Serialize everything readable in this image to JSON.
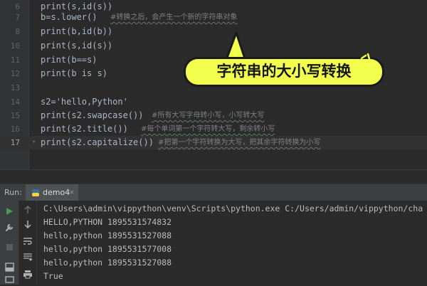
{
  "editor": {
    "lines": [
      {
        "num": "6",
        "code": "print(s,id(s))"
      },
      {
        "num": "7",
        "code": "b=s.lower()",
        "comment": "#转换之后，会产生一个新的字符串对象"
      },
      {
        "num": "8",
        "code": "print(b,id(b))"
      },
      {
        "num": "10",
        "code": "print(s,id(s))"
      },
      {
        "num": "11",
        "code": "print(b==s)"
      },
      {
        "num": "12",
        "code": "print(b is s)"
      },
      {
        "num": "13",
        "code": ""
      },
      {
        "num": "14",
        "code": "s2='hello,Python'"
      },
      {
        "num": "15",
        "code": "print(s2.swapcase())",
        "comment": "#所有大写字母转小写，小写转大写"
      },
      {
        "num": "16",
        "code": "print(s2.title())",
        "comment": "#每个单词第一个字符转大写，剩余转小写"
      },
      {
        "num": "17",
        "code": "print(s2.capitalize())",
        "comment": "#把第一个字符转换为大写，把其余字符转换为小写"
      }
    ]
  },
  "callout": {
    "text": "字符串的大小写转换",
    "bg": "#f3ff4d"
  },
  "run": {
    "label": "Run:",
    "tab": {
      "label": "demo4",
      "icon": "python-icon"
    }
  },
  "console": {
    "lines": [
      "C:\\Users\\admin\\vippython\\venv\\Scripts\\python.exe C:/Users/admin/vippython/cha",
      "HELLO,PYTHON 1895531574832",
      "hello,python 1895531527088",
      "hello,python 1895531577008",
      "hello,python 1895531527088",
      "True"
    ]
  },
  "toolbar": {
    "icons": [
      "run-icon",
      "wrench-icon",
      "stop-icon",
      "layout-icon",
      "up-arrow-icon",
      "down-arrow-icon",
      "soft-wrap-icon",
      "scroll-end-icon",
      "print-icon"
    ]
  },
  "colors": {
    "accent_run": "#499c54",
    "editor_bg": "#2b2b2b"
  }
}
